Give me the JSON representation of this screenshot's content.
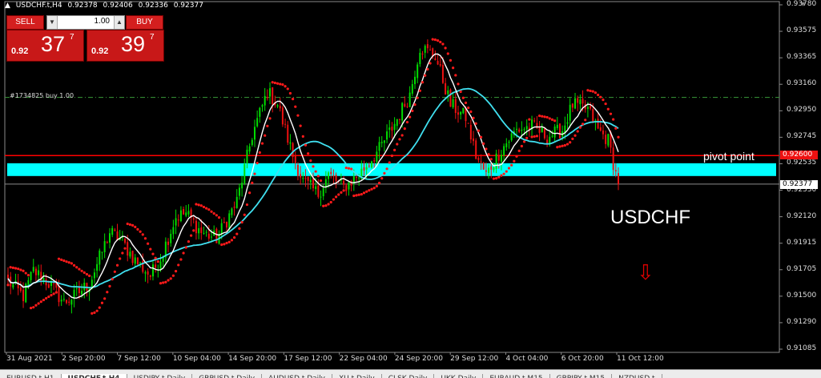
{
  "window": {
    "symbol": "USDCHF.t,H4",
    "ohlc": [
      "0.92378",
      "0.92406",
      "0.92336",
      "0.92377"
    ]
  },
  "trade_panel": {
    "sell_label": "SELL",
    "buy_label": "BUY",
    "lot_value": "1.00",
    "sell_price": {
      "prefix": "0.92",
      "big": "37",
      "sup": "7"
    },
    "buy_price": {
      "prefix": "0.92",
      "big": "39",
      "sup": "7"
    }
  },
  "order_label": "#1734825 buy 1.00",
  "annotations": {
    "pivot_label": "pivot point",
    "symbol_label": "USDCHF",
    "arrow_glyph": "⇩"
  },
  "price_tags": {
    "pivot": "0.92600",
    "current": "0.92377"
  },
  "price_axis": [
    "0.93780",
    "0.93575",
    "0.93365",
    "0.93160",
    "0.92950",
    "0.92745",
    "0.92535",
    "0.92330",
    "0.92120",
    "0.91915",
    "0.91705",
    "0.91500",
    "0.91290",
    "0.91085"
  ],
  "date_axis": [
    "31 Aug 2021",
    "2 Sep 20:00",
    "7 Sep 12:00",
    "10 Sep 04:00",
    "14 Sep 20:00",
    "17 Sep 12:00",
    "22 Sep 04:00",
    "24 Sep 20:00",
    "29 Sep 12:00",
    "4 Oct 04:00",
    "6 Oct 20:00",
    "11 Oct 12:00"
  ],
  "tabs": [
    "EURUSD,t,H1",
    "USDCHF,t,H4",
    "USDJPY,t,Daily",
    "GBPUSD,t,Daily",
    "AUDUSD,t,Daily",
    "XU,t,Daily",
    "CLSK,Daily",
    "UKK,Daily",
    "EURAUD,t,M15",
    "GBPJPY,t,M15",
    "NZDUSD,t"
  ],
  "active_tab": 1,
  "colors": {
    "bull": "#00dd00",
    "bear": "#ee1111",
    "sar": "#ff1a1a",
    "ma_fast": "#ffffff",
    "ma_slow": "#40e0f0",
    "pivot_line": "#ff0000",
    "zone": "#00ffff"
  },
  "chart_data": {
    "type": "candlestick",
    "symbol": "USDCHF",
    "timeframe": "H4",
    "y_range": [
      0.91085,
      0.9378
    ],
    "pivot_level": 0.926,
    "order_level": 0.93055,
    "current_price": 0.92377,
    "zone": [
      0.9244,
      0.9254
    ],
    "waypoints": [
      [
        0,
        0.9162
      ],
      [
        6,
        0.915
      ],
      [
        10,
        0.917
      ],
      [
        16,
        0.916
      ],
      [
        22,
        0.9145
      ],
      [
        26,
        0.915
      ],
      [
        32,
        0.916
      ],
      [
        36,
        0.918
      ],
      [
        40,
        0.92
      ],
      [
        44,
        0.9195
      ],
      [
        50,
        0.9178
      ],
      [
        56,
        0.9166
      ],
      [
        60,
        0.918
      ],
      [
        66,
        0.9212
      ],
      [
        70,
        0.9215
      ],
      [
        76,
        0.92
      ],
      [
        82,
        0.9195
      ],
      [
        90,
        0.9224
      ],
      [
        96,
        0.9276
      ],
      [
        102,
        0.931
      ],
      [
        106,
        0.93
      ],
      [
        112,
        0.926
      ],
      [
        116,
        0.924
      ],
      [
        122,
        0.923
      ],
      [
        126,
        0.9245
      ],
      [
        132,
        0.9235
      ],
      [
        138,
        0.9245
      ],
      [
        146,
        0.9265
      ],
      [
        152,
        0.9285
      ],
      [
        158,
        0.9308
      ],
      [
        162,
        0.9345
      ],
      [
        168,
        0.9338
      ],
      [
        174,
        0.93
      ],
      [
        180,
        0.929
      ],
      [
        184,
        0.926
      ],
      [
        188,
        0.9245
      ],
      [
        194,
        0.9265
      ],
      [
        200,
        0.928
      ],
      [
        206,
        0.9283
      ],
      [
        212,
        0.9275
      ],
      [
        218,
        0.928
      ],
      [
        222,
        0.93
      ],
      [
        228,
        0.9296
      ],
      [
        232,
        0.928
      ],
      [
        236,
        0.9272
      ],
      [
        240,
        0.9237
      ]
    ]
  }
}
